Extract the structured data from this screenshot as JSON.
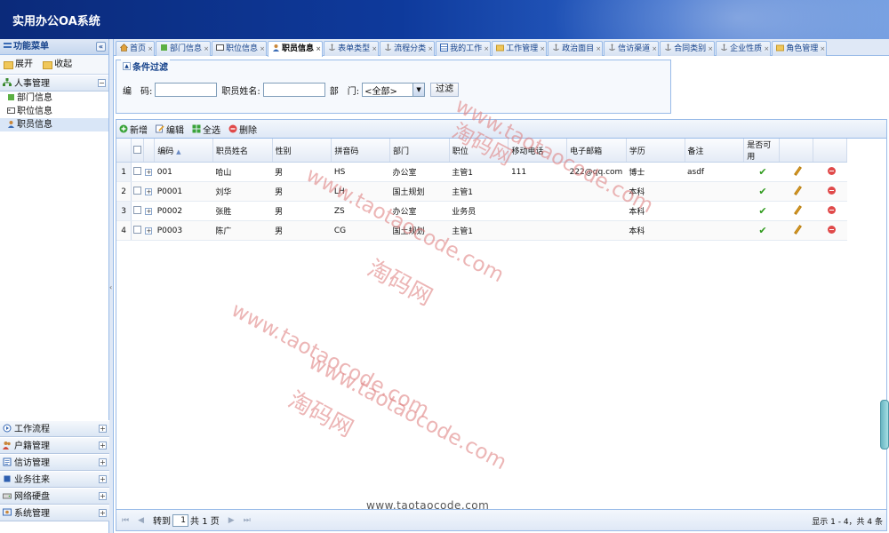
{
  "app": {
    "title": "实用办公OA系统"
  },
  "sidebar": {
    "header": "功能菜单",
    "collapse_symbol": "«",
    "expand_label": "展开",
    "collapse_label": "收起",
    "groups": [
      {
        "label": "人事管理",
        "toggle": "−",
        "items": [
          {
            "label": "部门信息"
          },
          {
            "label": "职位信息"
          },
          {
            "label": "职员信息"
          }
        ]
      },
      {
        "label": "工作流程",
        "toggle": "+"
      },
      {
        "label": "户籍管理",
        "toggle": "+"
      },
      {
        "label": "信访管理",
        "toggle": "+"
      },
      {
        "label": "业务往来",
        "toggle": "+"
      },
      {
        "label": "网络硬盘",
        "toggle": "+"
      },
      {
        "label": "系统管理",
        "toggle": "+"
      }
    ]
  },
  "tabs": [
    {
      "label": "首页"
    },
    {
      "label": "部门信息"
    },
    {
      "label": "职位信息"
    },
    {
      "label": "职员信息"
    },
    {
      "label": "表单类型"
    },
    {
      "label": "流程分类"
    },
    {
      "label": "我的工作"
    },
    {
      "label": "工作管理"
    },
    {
      "label": "政治面目"
    },
    {
      "label": "信访渠道"
    },
    {
      "label": "合同类别"
    },
    {
      "label": "企业性质"
    },
    {
      "label": "角色管理"
    }
  ],
  "filter": {
    "title": "条件过滤",
    "code_label": "编　码:",
    "name_label": "职员姓名:",
    "dept_label": "部　门:",
    "code_value": "",
    "name_value": "",
    "dept_value": "<全部>",
    "submit_label": "过滤"
  },
  "toolbar": {
    "new_label": "新增",
    "edit_label": "编辑",
    "select_all_label": "全选",
    "delete_label": "删除"
  },
  "table": {
    "columns": [
      "编码",
      "职员姓名",
      "性别",
      "拼音码",
      "部门",
      "职位",
      "移动电话",
      "电子邮箱",
      "学历",
      "备注",
      "是否可用"
    ],
    "sort_indicator": "▲",
    "rows": [
      {
        "num": "1",
        "code": "001",
        "name": "哈山",
        "gender": "男",
        "pinyin": "HS",
        "dept": "办公室",
        "position": "主管1",
        "mobile": "111",
        "email": "222@qq.com",
        "education": "博士",
        "remark": "asdf",
        "enabled": "✔"
      },
      {
        "num": "2",
        "code": "P0001",
        "name": "刘华",
        "gender": "男",
        "pinyin": "LH",
        "dept": "国土规划",
        "position": "主管1",
        "mobile": "",
        "email": "",
        "education": "本科",
        "remark": "",
        "enabled": "✔"
      },
      {
        "num": "3",
        "code": "P0002",
        "name": "张胜",
        "gender": "男",
        "pinyin": "ZS",
        "dept": "办公室",
        "position": "业务员",
        "mobile": "",
        "email": "",
        "education": "本科",
        "remark": "",
        "enabled": "✔"
      },
      {
        "num": "4",
        "code": "P0003",
        "name": "陈广",
        "gender": "男",
        "pinyin": "CG",
        "dept": "国土规划",
        "position": "主管1",
        "mobile": "",
        "email": "",
        "education": "本科",
        "remark": "",
        "enabled": "✔"
      }
    ]
  },
  "pager": {
    "first": "⏮",
    "prev": "◀",
    "next": "▶",
    "last": "⏭",
    "goto_label": "转到",
    "page_value": "1",
    "page_suffix": "共 1 页",
    "info": "显示 1 - 4，共 4 条"
  },
  "watermarks": {
    "url": "www.taotaocode.com",
    "cn": "淘码网",
    "bottom": "www.taotaocode.com"
  }
}
